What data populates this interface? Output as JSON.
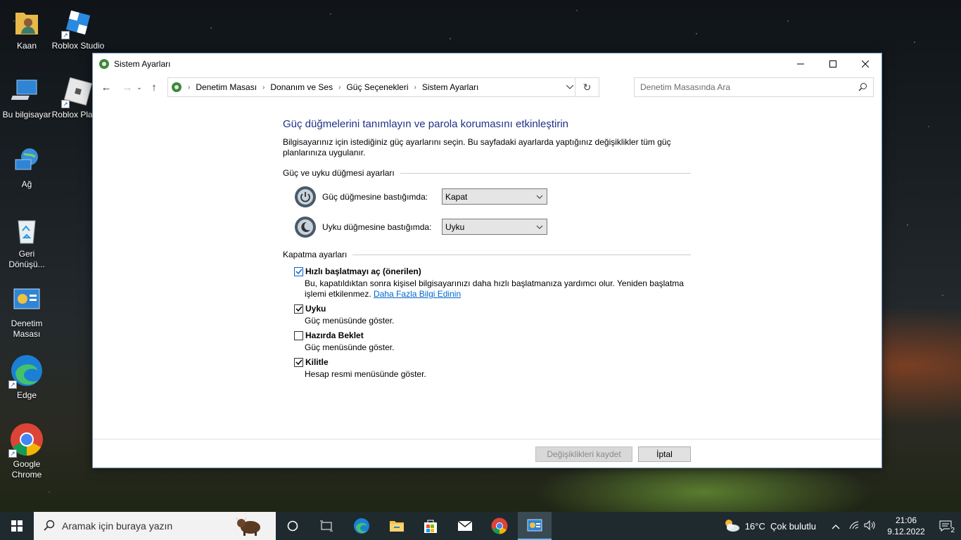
{
  "desktop": {
    "icons": [
      {
        "label": "Kaan"
      },
      {
        "label": "Roblox Studio"
      },
      {
        "label": "Bu bilgisayar"
      },
      {
        "label": "Roblox Player"
      },
      {
        "label": "Ağ"
      },
      {
        "label": "Geri Dönüşü..."
      },
      {
        "label": "Denetim Masası"
      },
      {
        "label": "Edge"
      },
      {
        "label": "Google Chrome"
      }
    ]
  },
  "window": {
    "title": "Sistem Ayarları",
    "breadcrumb": [
      "Denetim Masası",
      "Donanım ve Ses",
      "Güç Seçenekleri",
      "Sistem Ayarları"
    ],
    "search_placeholder": "Denetim Masasında Ara",
    "heading": "Güç düğmelerini tanımlayın ve parola korumasını etkinleştirin",
    "description": "Bilgisayarınız için istediğiniz güç ayarlarını seçin. Bu sayfadaki ayarlarda yaptığınız değişiklikler tüm güç planlarınıza uygulanır.",
    "power_section": {
      "title": "Güç ve uyku düğmesi ayarları",
      "power_button_label": "Güç düğmesine bastığımda:",
      "power_button_value": "Kapat",
      "sleep_button_label": "Uyku düğmesine bastığımda:",
      "sleep_button_value": "Uyku"
    },
    "shutdown_section": {
      "title": "Kapatma ayarları",
      "options": [
        {
          "label": "Hızlı başlatmayı aç (önerilen)",
          "desc": "Bu, kapatıldıktan sonra kişisel bilgisayarınızı daha hızlı başlatmanıza yardımcı olur. Yeniden başlatma işlemi etkilenmez.",
          "link": "Daha Fazla Bilgi Edinin",
          "checked": true
        },
        {
          "label": "Uyku",
          "desc": "Güç menüsünde göster.",
          "checked": true
        },
        {
          "label": "Hazırda Beklet",
          "desc": "Güç menüsünde göster.",
          "checked": false
        },
        {
          "label": "Kilitle",
          "desc": "Hesap resmi menüsünde göster.",
          "checked": true
        }
      ]
    },
    "footer": {
      "save_label": "Değişiklikleri kaydet",
      "cancel_label": "İptal"
    }
  },
  "taskbar": {
    "search_placeholder": "Aramak için buraya yazın",
    "weather": "16°C  Çok bulutlu",
    "time": "21:06",
    "date": "9.12.2022",
    "notifications": "2"
  },
  "colors": {
    "heading": "#1e3287",
    "link": "#0066cc",
    "taskbar": "#1f2a2f"
  }
}
